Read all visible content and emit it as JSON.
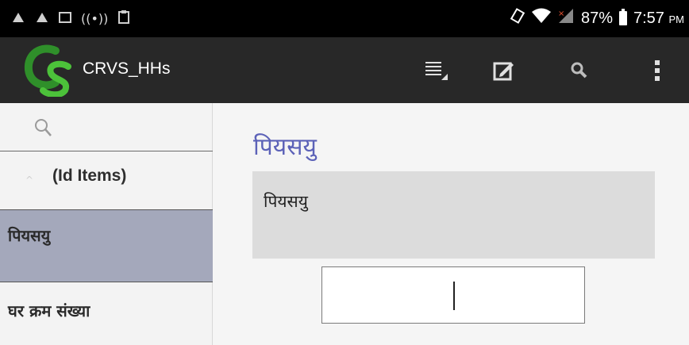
{
  "status_bar": {
    "battery_percent": "87%",
    "time": "7:57",
    "time_suffix": "PM"
  },
  "action_bar": {
    "title": "CRVS_HHs",
    "buttons": [
      "list-icon",
      "edit-icon",
      "search-icon",
      "overflow-menu-icon"
    ]
  },
  "sidebar": {
    "group_label": "(Id Items)",
    "items": [
      {
        "label": "पियसयु",
        "selected": true
      },
      {
        "label": "घर क्रम संख्या",
        "selected": false
      }
    ]
  },
  "question": {
    "title": "पियसयु",
    "text": "पियसयु",
    "answer_value": ""
  },
  "colors": {
    "action_bar_bg": "#282828",
    "selected_item_bg": "#a4a8bb",
    "question_title": "#5c62b8",
    "question_box_bg": "#dcdcdc"
  }
}
